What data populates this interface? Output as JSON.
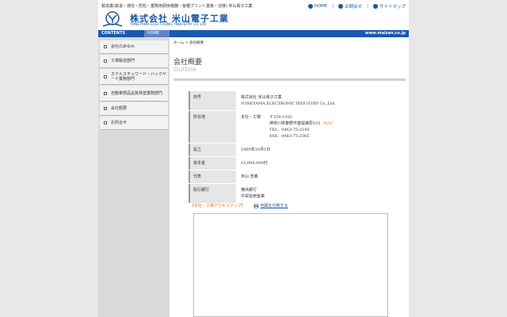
{
  "header": {
    "tagline": "製造業(鉄道・通信・防犯・業務用厨房機器・各種プリント基板・溶接) 米山電子工業",
    "brand_jp": "株式会社 米山電子工業",
    "brand_en": "YONEYAMA ELECTRONIC INDUSTRY Co.,Ltd.",
    "links": [
      "HOME",
      "お問合せ",
      "サイトマップ"
    ]
  },
  "navbar": {
    "contents": "CONTENTS",
    "home": "HOME",
    "url": "www.maizan.co.jp"
  },
  "sidebar": {
    "items": [
      {
        "label": "会社のあゆみ"
      },
      {
        "label": "工場製造部門"
      },
      {
        "label": "ホテルスチュワード・バックヤード業務部門"
      },
      {
        "label": "自動車部品品質検査業務部門"
      },
      {
        "label": "会社概要"
      },
      {
        "label": "お問合せ"
      }
    ]
  },
  "breadcrumb": "ホーム > 会社概要",
  "page_title_jp": "会社概要",
  "page_title_en": "Outline",
  "company": {
    "name_label": "商号",
    "name_jp": "株式会社 米山電子工業",
    "name_en": "YONEYAMA ELECTRONIC INDUSTRY Co.,Ltd.",
    "address_label": "所在地",
    "address_type": "本社・工場",
    "postal": "〒259-1302",
    "address": "神奈川県秦野市菩提東原105",
    "map_link": "MAP",
    "tel": "TEL．0463-75-2140",
    "fax": "FAX．0463-75-2365",
    "established_label": "設立",
    "established": "1969年10月1日",
    "capital_label": "資本金",
    "capital": "15,000,000円",
    "rep_label": "代表",
    "rep": "米山 忠義",
    "bank_label": "取引銀行",
    "bank1": "横浜銀行",
    "bank2": "中栄信用金庫"
  },
  "access": {
    "title": "【本社・工場アクセスマップ】",
    "print": "地図を印刷する"
  },
  "colors": {
    "brand_blue": "#1b58b0",
    "accent_orange": "#e07b1b"
  }
}
